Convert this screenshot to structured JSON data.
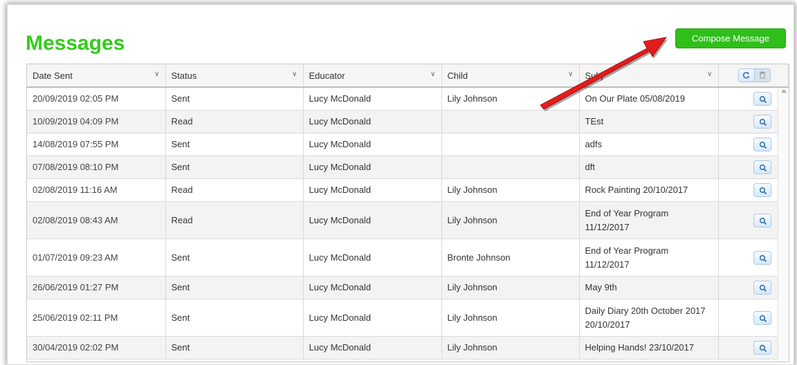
{
  "page": {
    "title": "Messages"
  },
  "toolbar": {
    "compose_label": "Compose Message"
  },
  "table": {
    "columns": [
      "Date Sent",
      "Status",
      "Educator",
      "Child",
      "Subject"
    ],
    "columns_visible": [
      "Date Sent",
      "Status",
      "Educator",
      "Child",
      "Subj"
    ],
    "header_actions": [
      "refresh-icon",
      "trash-icon"
    ],
    "rows": [
      {
        "date": "20/09/2019 02:05 PM",
        "status": "Sent",
        "educator": "Lucy McDonald",
        "child": "Lily Johnson",
        "subject": "On Our Plate 05/08/2019"
      },
      {
        "date": "10/09/2019 04:09 PM",
        "status": "Read",
        "educator": "Lucy McDonald",
        "child": "",
        "subject": "TEst"
      },
      {
        "date": "14/08/2019 07:55 PM",
        "status": "Sent",
        "educator": "Lucy McDonald",
        "child": "",
        "subject": "adfs"
      },
      {
        "date": "07/08/2019 08:10 PM",
        "status": "Sent",
        "educator": "Lucy McDonald",
        "child": "",
        "subject": "dft"
      },
      {
        "date": "02/08/2019 11:16 AM",
        "status": "Read",
        "educator": "Lucy McDonald",
        "child": "Lily Johnson",
        "subject": "Rock Painting 20/10/2017"
      },
      {
        "date": "02/08/2019 08:43 AM",
        "status": "Read",
        "educator": "Lucy McDonald",
        "child": "Lily Johnson",
        "subject": "End of Year Program 11/12/2017"
      },
      {
        "date": "01/07/2019 09:23 AM",
        "status": "Sent",
        "educator": "Lucy McDonald",
        "child": "Bronte Johnson",
        "subject": "End of Year Program 11/12/2017"
      },
      {
        "date": "26/06/2019 01:27 PM",
        "status": "Sent",
        "educator": "Lucy McDonald",
        "child": "Lily Johnson",
        "subject": "May 9th"
      },
      {
        "date": "25/06/2019 02:11 PM",
        "status": "Sent",
        "educator": "Lucy McDonald",
        "child": "Lily Johnson",
        "subject": "Daily Diary 20th October 2017 20/10/2017"
      },
      {
        "date": "30/04/2019 02:02 PM",
        "status": "Sent",
        "educator": "Lucy McDonald",
        "child": "Lily Johnson",
        "subject": "Helping Hands! 23/10/2017"
      }
    ]
  },
  "colors": {
    "title": "#33cc1a",
    "compose_bg": "#2fbf1a",
    "annotation_arrow": "#e01010"
  },
  "row_action_icon": "search-icon"
}
